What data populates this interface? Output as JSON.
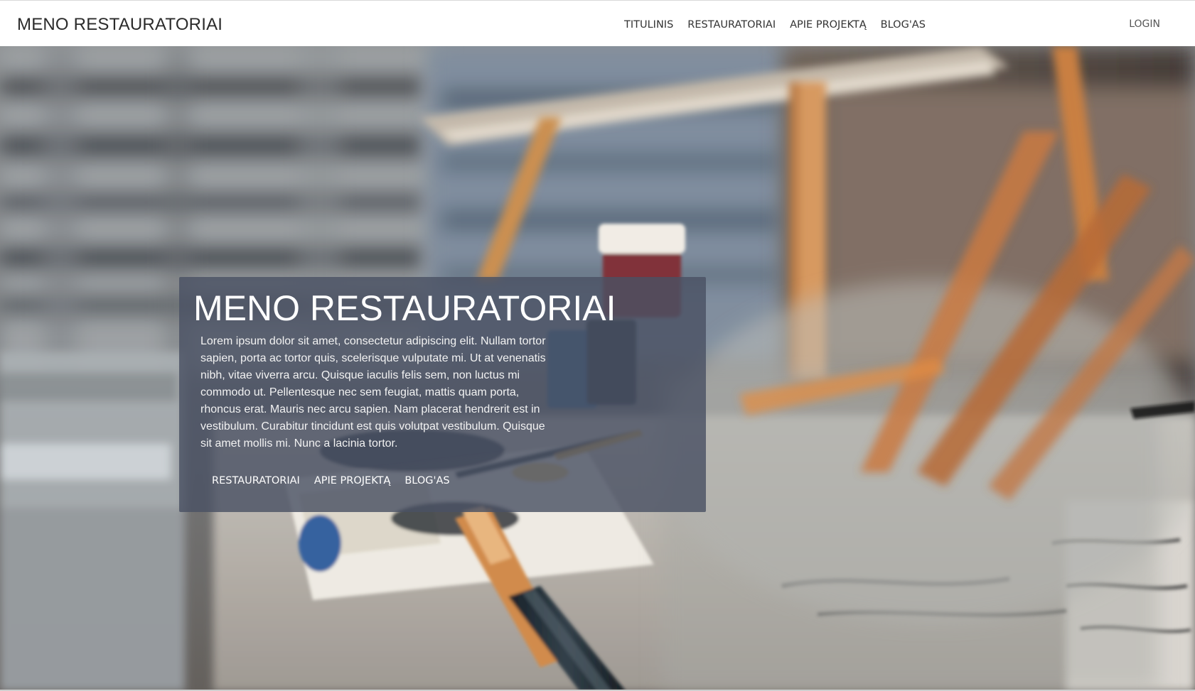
{
  "navbar": {
    "brand": "MENO RESTAURATORIAI",
    "links": [
      "TITULINIS",
      "RESTAURATORIAI",
      "APIE PROJEKTĄ",
      "BLOG'AS"
    ],
    "login": "LOGIN"
  },
  "hero": {
    "background_image": "blurred-painting-studio-photo",
    "card": {
      "title": "MENO RESTAURATORIAI",
      "text": "Lorem ipsum dolor sit amet, consectetur adipiscing elit. Nullam tortor sapien, porta ac tortor quis, scelerisque vulputate mi. Ut at venenatis nibh, vitae viverra arcu. Quisque iaculis felis sem, non luctus mi commodo ut. Pellentesque nec sem feugiat, mattis quam porta, rhoncus erat. Mauris nec arcu sapien. Nam placerat hendrerit est in vestibulum. Curabitur tincidunt est quis volutpat vestibulum. Quisque sit amet mollis mi. Nunc a lacinia tortor.",
      "links": [
        "RESTAURATORIAI",
        "APIE PROJEKTĄ",
        "BLOG'AS"
      ]
    }
  },
  "colors": {
    "navbar_bg": "#ffffff",
    "card_bg": "#4a5264",
    "card_text": "#ffffff"
  }
}
